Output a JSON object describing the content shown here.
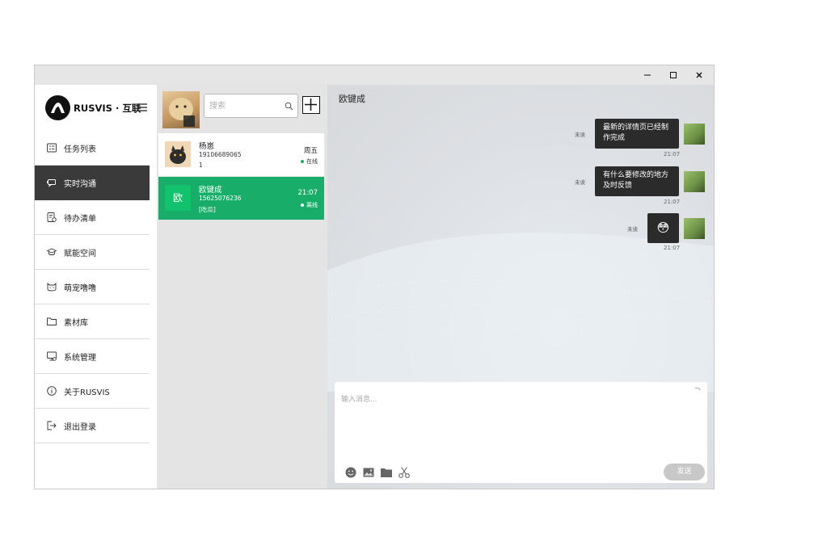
{
  "window": {
    "minimize": "—",
    "maximize": "☐",
    "close": "✕"
  },
  "sidebar": {
    "brand": "RUSVIS · 互联",
    "items": [
      {
        "label": "任务列表",
        "icon": "task-list-icon",
        "active": false
      },
      {
        "label": "实时沟通",
        "icon": "chat-icon",
        "active": true
      },
      {
        "label": "待办清单",
        "icon": "todo-icon",
        "active": false
      },
      {
        "label": "赋能空间",
        "icon": "graduation-cap-icon",
        "active": false
      },
      {
        "label": "萌宠噜噜",
        "icon": "pet-icon",
        "active": false
      },
      {
        "label": "素材库",
        "icon": "folder-icon",
        "active": false
      },
      {
        "label": "系统管理",
        "icon": "monitor-icon",
        "active": false
      },
      {
        "label": "关于RUSVIS",
        "icon": "info-icon",
        "active": false
      },
      {
        "label": "退出登录",
        "icon": "logout-icon",
        "active": false
      }
    ]
  },
  "contacts": {
    "search_placeholder": "搜索",
    "list": [
      {
        "name": "杨崽",
        "phone": "19106689065",
        "last": "1",
        "time": "周五",
        "status": "在线",
        "status_color": "#18ae6a",
        "avatar": "cat-photo"
      },
      {
        "name": "欧键成",
        "phone": "15625076236",
        "last": "[吃瓜]",
        "time": "21:07",
        "status": "离线",
        "status_color": "#ffffff",
        "avatar": "欧"
      }
    ]
  },
  "chat": {
    "title": "欧键成",
    "messages": [
      {
        "text_line1": "最新的详情页已经制",
        "text_line2": "作完成",
        "unread": "未读",
        "time": "21:07"
      },
      {
        "text_line1": "有什么要修改的地方",
        "text_line2": "及时反馈",
        "unread": "未读",
        "time": "21:07"
      },
      {
        "emoji": "😳",
        "unread": "未读",
        "time": "21:07"
      }
    ],
    "input_placeholder": "输入消息...",
    "send_label": "发送"
  },
  "colors": {
    "accent": "#18ae6a",
    "active_nav": "#3a3a3a",
    "bubble": "#2b2b2b"
  }
}
